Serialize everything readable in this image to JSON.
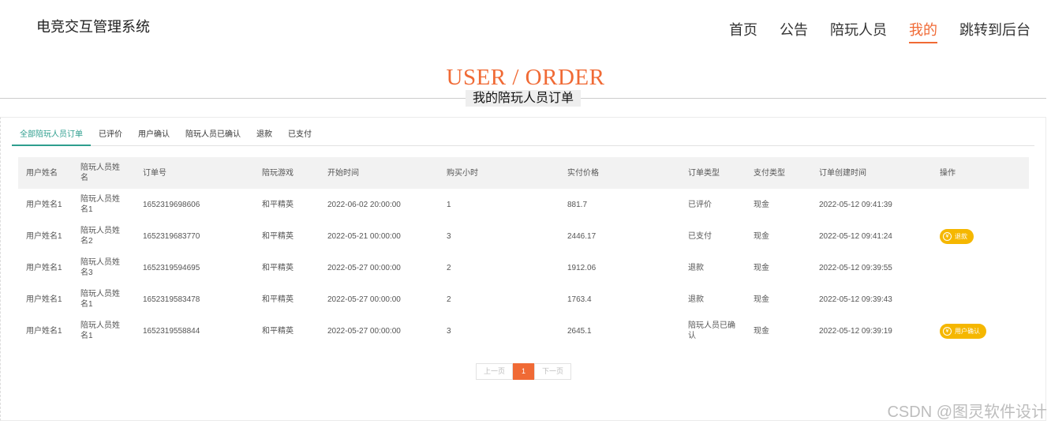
{
  "header": {
    "site_title": "电竞交互管理系统",
    "nav": [
      {
        "label": "首页",
        "active": false
      },
      {
        "label": "公告",
        "active": false
      },
      {
        "label": "陪玩人员",
        "active": false
      },
      {
        "label": "我的",
        "active": true
      },
      {
        "label": "跳转到后台",
        "active": false
      }
    ]
  },
  "heading": {
    "en": "USER / ORDER",
    "cn": "我的陪玩人员订单"
  },
  "tabs": [
    {
      "label": "全部陪玩人员订单",
      "active": true
    },
    {
      "label": "已评价",
      "active": false
    },
    {
      "label": "用户确认",
      "active": false
    },
    {
      "label": "陪玩人员已确认",
      "active": false
    },
    {
      "label": "退款",
      "active": false
    },
    {
      "label": "已支付",
      "active": false
    }
  ],
  "table": {
    "columns": [
      "用户姓名",
      "陪玩人员姓名",
      "订单号",
      "陪玩游戏",
      "开始时间",
      "购买小时",
      "实付价格",
      "订单类型",
      "支付类型",
      "订单创建时间",
      "操作"
    ],
    "rows": [
      {
        "cells": [
          "用户姓名1",
          "陪玩人员姓名1",
          "1652319698606",
          "和平精英",
          "2022-06-02 20:00:00",
          "1",
          "881.7",
          "已评价",
          "现金",
          "2022-05-12 09:41:39"
        ],
        "action": ""
      },
      {
        "cells": [
          "用户姓名1",
          "陪玩人员姓名2",
          "1652319683770",
          "和平精英",
          "2022-05-21 00:00:00",
          "3",
          "2446.17",
          "已支付",
          "现金",
          "2022-05-12 09:41:24"
        ],
        "action": "退款"
      },
      {
        "cells": [
          "用户姓名1",
          "陪玩人员姓名3",
          "1652319594695",
          "和平精英",
          "2022-05-27 00:00:00",
          "2",
          "1912.06",
          "退款",
          "现金",
          "2022-05-12 09:39:55"
        ],
        "action": ""
      },
      {
        "cells": [
          "用户姓名1",
          "陪玩人员姓名1",
          "1652319583478",
          "和平精英",
          "2022-05-27 00:00:00",
          "2",
          "1763.4",
          "退款",
          "现金",
          "2022-05-12 09:39:43"
        ],
        "action": ""
      },
      {
        "cells": [
          "用户姓名1",
          "陪玩人员姓名1",
          "1652319558844",
          "和平精英",
          "2022-05-27 00:00:00",
          "3",
          "2645.1",
          "陪玩人员已确认",
          "现金",
          "2022-05-12 09:39:19"
        ],
        "action": "用户确认"
      }
    ]
  },
  "action_icon": "yen-circle-icon",
  "pagination": {
    "prev": "上一页",
    "current": "1",
    "next": "下一页"
  },
  "watermark": "CSDN @图灵软件设计",
  "colors": {
    "accent": "#f06a35",
    "tab_active": "#2e9e8e",
    "button": "#f5b700"
  }
}
